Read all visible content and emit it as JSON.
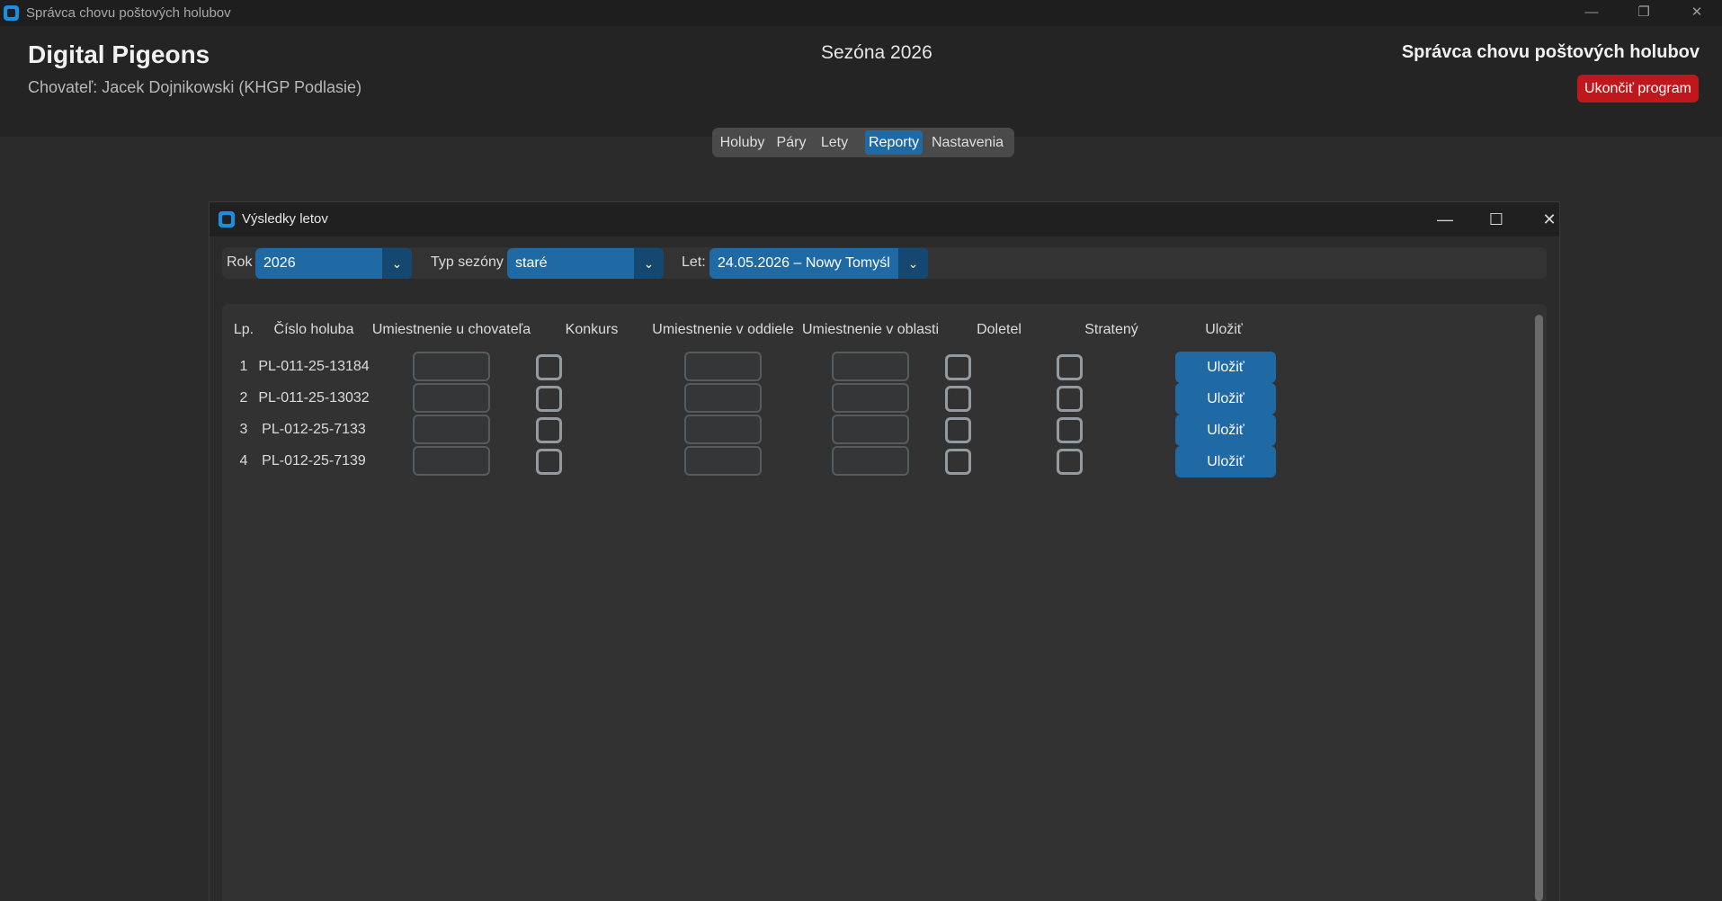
{
  "os_window": {
    "title": "Správca chovu poštových holubov",
    "minimize": "—",
    "restore": "❐",
    "close": "✕"
  },
  "header": {
    "brand": "Digital Pigeons",
    "breeder": "Chovateľ: Jacek Dojnikowski (KHGP Podlasie)",
    "season": "Sezóna 2026",
    "app_name": "Správca chovu poštových holubov",
    "quit_label": "Ukončiť program",
    "quit_color": "#c0171d"
  },
  "nav": {
    "tabs": [
      "Holuby",
      "Páry",
      "Lety",
      "Reporty",
      "Nastavenia"
    ],
    "active": "Reporty",
    "accent": "#1f6aa5"
  },
  "child_window": {
    "title": "Výsledky letov",
    "minimize": "—",
    "maximize": "☐",
    "close": "✕"
  },
  "filters": {
    "year_label": "Rok",
    "year_value": "2026",
    "season_type_label": "Typ sezóny",
    "season_type_value": "staré",
    "flight_label": "Let:",
    "flight_value": "24.05.2026 – Nowy Tomyśl",
    "arrow": "⌄"
  },
  "table": {
    "headers": [
      "Lp.",
      "Číslo holuba",
      "Umiestnenie u chovateľa",
      "Konkurs",
      "Umiestnenie v oddiele",
      "Umiestnenie v oblasti",
      "Doletel",
      "Stratený",
      "Uložiť"
    ],
    "rows": [
      {
        "lp": "1",
        "ring": "PL-011-25-13184",
        "save": "Uložiť"
      },
      {
        "lp": "2",
        "ring": "PL-011-25-13032",
        "save": "Uložiť"
      },
      {
        "lp": "3",
        "ring": "PL-012-25-7133",
        "save": "Uložiť"
      },
      {
        "lp": "4",
        "ring": "PL-012-25-7139",
        "save": "Uložiť"
      }
    ]
  }
}
